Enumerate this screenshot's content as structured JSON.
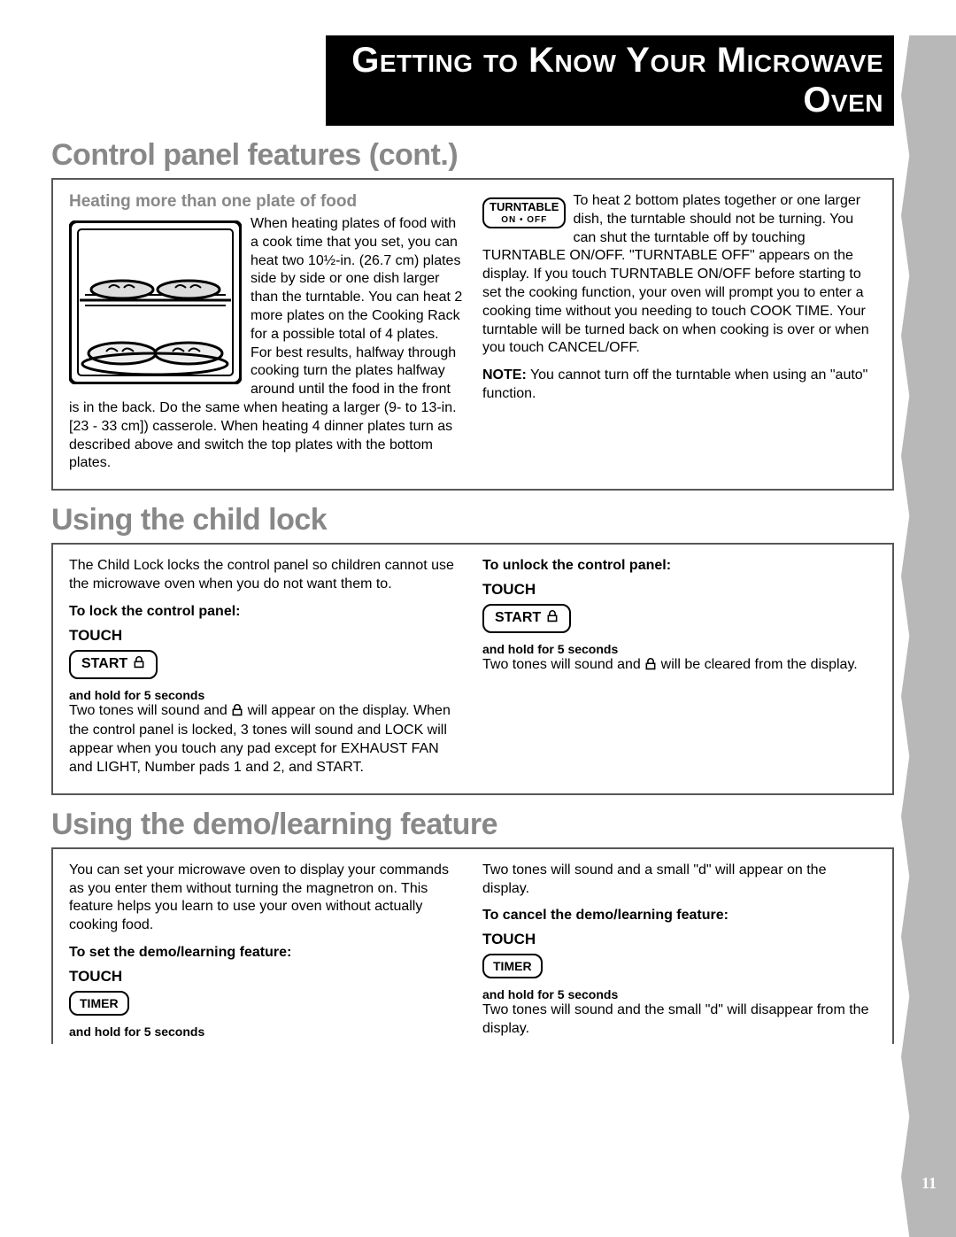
{
  "header": {
    "title": "Getting to Know Your Microwave Oven"
  },
  "page_number": "11",
  "section1": {
    "title": "Control panel features (cont.)",
    "sub_head": "Heating more than one plate of food",
    "p1": "When heating plates of food with a cook time that you set, you can heat two 10½-in. (26.7 cm) plates side by side or one dish larger than the turntable. You can heat 2 more plates on the Cooking Rack for a possible total of 4 plates. For best results, halfway through cooking turn the plates halfway around until the food in the front is in the back. Do the same when heating a larger (9- to 13-in. [23 - 33 cm]) casserole. When heating 4 dinner plates turn as described above and switch the top plates with the bottom plates.",
    "right_intro": "To heat 2 bottom plates together or one larger dish, the turntable should not be turning. You can shut the turntable off by touching TURNTABLE ON/OFF. \"TURNTABLE OFF\" appears on the display. If you touch TURNTABLE ON/OFF before starting to set the cooking function, your oven will prompt you to enter a cooking time without you needing to touch COOK TIME. Your turntable will be turned back on when cooking is over or when you touch CANCEL/OFF.",
    "note_label": "NOTE:",
    "note_body": "You cannot turn off the turntable when using an \"auto\" function.",
    "turntable_btn": "TURNTABLE",
    "turntable_sub": "ON • OFF"
  },
  "section2": {
    "title": "Using the child lock",
    "intro": "The Child Lock locks the control panel so children cannot use the microwave oven when you do not want them to.",
    "lock_head": "To lock the control panel:",
    "touch": "TOUCH",
    "start": "START",
    "hold": "and hold for 5 seconds",
    "lock_result_pre": "Two tones will sound and ",
    "lock_result_post": " will appear on the display. When the control panel is locked, 3 tones will sound and LOCK will appear when you touch any pad except for EXHAUST FAN and LIGHT, Number pads 1 and 2, and START.",
    "unlock_head": "To unlock the control panel:",
    "unlock_result_pre": "Two tones will sound and ",
    "unlock_result_post": " will be cleared from the display."
  },
  "section3": {
    "title": "Using the demo/learning feature",
    "intro": "You can set your microwave oven to display your commands as you enter them without turning the magnetron on. This feature helps you learn to use your oven without actually cooking food.",
    "set_head": "To set the demo/learning feature:",
    "touch": "TOUCH",
    "timer": "TIMER",
    "hold": "and hold for 5 seconds",
    "set_result": "Two tones will sound and a small \"d\" will appear on the display.",
    "cancel_head": "To cancel the demo/learning feature:",
    "cancel_result": "Two tones will sound and the small \"d\" will disappear from the display."
  }
}
